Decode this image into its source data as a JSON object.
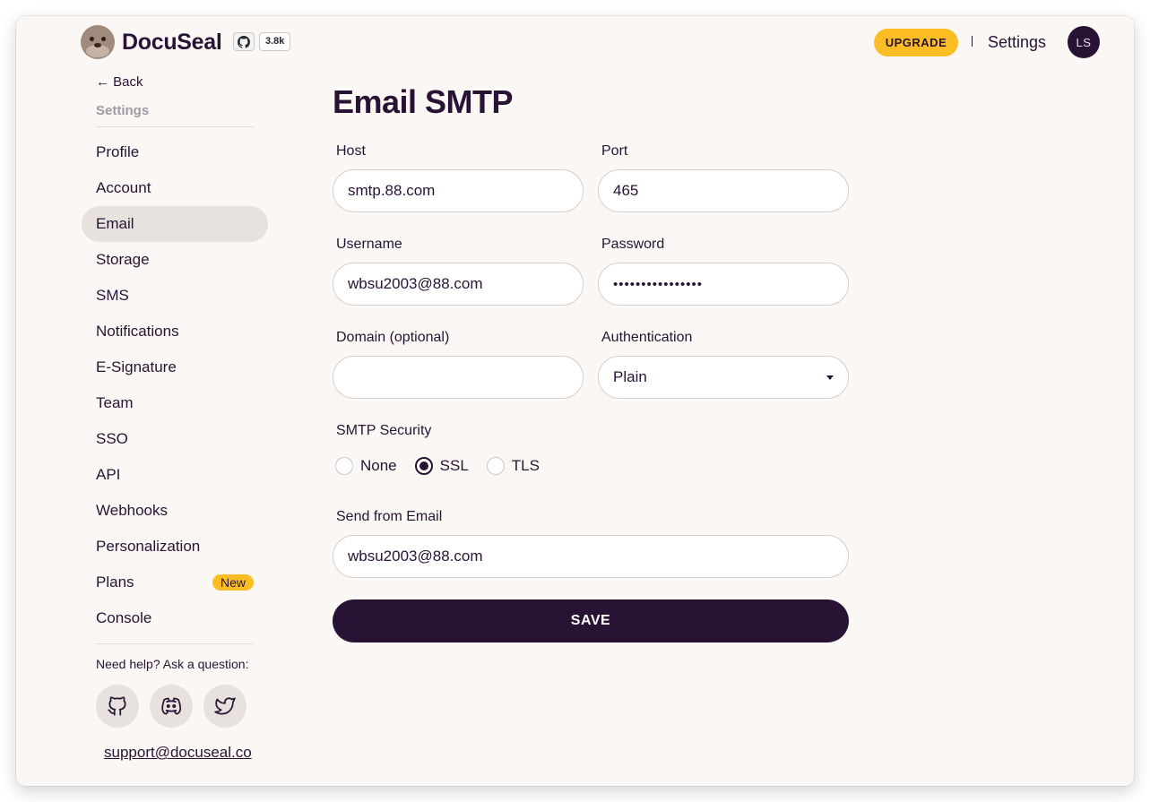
{
  "header": {
    "brand": "DocuSeal",
    "github_stars": "3.8k",
    "upgrade_label": "UPGRADE",
    "settings_label": "Settings",
    "avatar_initials": "LS"
  },
  "sidebar": {
    "back_label": "← Back",
    "section_title": "Settings",
    "items": [
      {
        "label": "Profile"
      },
      {
        "label": "Account"
      },
      {
        "label": "Email",
        "active": true
      },
      {
        "label": "Storage"
      },
      {
        "label": "SMS"
      },
      {
        "label": "Notifications"
      },
      {
        "label": "E-Signature"
      },
      {
        "label": "Team"
      },
      {
        "label": "SSO"
      },
      {
        "label": "API"
      },
      {
        "label": "Webhooks"
      },
      {
        "label": "Personalization"
      },
      {
        "label": "Plans",
        "badge": "New"
      },
      {
        "label": "Console"
      }
    ],
    "help_text": "Need help? Ask a question:",
    "social_icons": [
      "github-icon",
      "discord-icon",
      "twitter-icon"
    ],
    "support_email": "support@docuseal.co"
  },
  "main": {
    "title": "Email SMTP",
    "host": {
      "label": "Host",
      "value": "smtp.88.com"
    },
    "port": {
      "label": "Port",
      "value": "465"
    },
    "username": {
      "label": "Username",
      "value": "wbsu2003@88.com"
    },
    "password": {
      "label": "Password",
      "value": "••••••••••••••••"
    },
    "domain": {
      "label": "Domain (optional)",
      "value": ""
    },
    "authentication": {
      "label": "Authentication",
      "value": "Plain"
    },
    "security": {
      "label": "SMTP Security",
      "options": [
        "None",
        "SSL",
        "TLS"
      ],
      "selected": "SSL"
    },
    "from_email": {
      "label": "Send from Email",
      "value": "wbsu2003@88.com"
    },
    "save_label": "SAVE"
  },
  "colors": {
    "primary": "#291334",
    "accent": "#fbbd23",
    "background": "#faf7f5"
  }
}
